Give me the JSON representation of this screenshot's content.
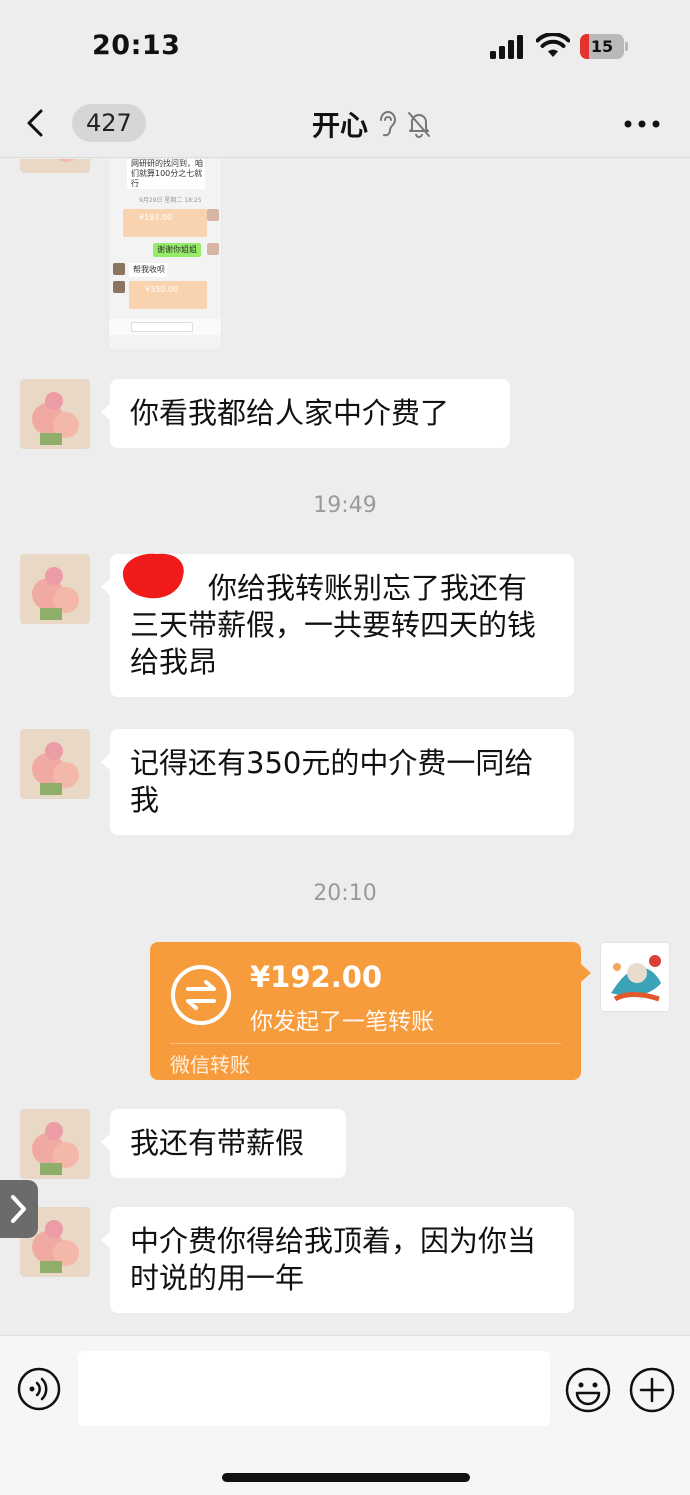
{
  "status_bar": {
    "time": "20:13",
    "battery": "15",
    "battery_color": "#e5322d"
  },
  "nav": {
    "back_count": "427",
    "title": "开心",
    "icons": [
      "chevron-left-icon",
      "ear-icon",
      "mute-bell-icon",
      "more-icon"
    ]
  },
  "embedded_screenshot": {
    "lines": [
      "网研研的找问到，咱",
      "们就算100分之七就",
      "行"
    ],
    "date_line": "9月29日 星期二 18:25",
    "thanks": "谢谢你姐姐",
    "help": "帮我收呗",
    "amount1": "¥193.00",
    "amount2": "¥350.00"
  },
  "messages": [
    {
      "id": "m1",
      "text": "你看我都给人家中介费了",
      "sender": "other"
    },
    {
      "id": "t1",
      "text": "19:49",
      "type": "timestamp"
    },
    {
      "id": "m2",
      "text": "你给我转账别忘了我还有三天带薪假，一共要转四天的钱给我昂",
      "sender": "other",
      "redacted_prefix": true
    },
    {
      "id": "m3",
      "text": "记得还有350元的中介费一同给我",
      "sender": "other"
    },
    {
      "id": "t2",
      "text": "20:10",
      "type": "timestamp"
    },
    {
      "id": "m5",
      "text": "我还有带薪假",
      "sender": "other"
    },
    {
      "id": "m6",
      "text": "中介费你得给我顶着，因为你当时说的用一年",
      "sender": "other"
    }
  ],
  "transfer": {
    "amount": "¥192.00",
    "description": "你发起了一笔转账",
    "footer": "微信转账",
    "color": "#f79c3c"
  },
  "input_bar": {
    "value": "",
    "icons": [
      "voice-icon",
      "emoji-icon",
      "plus-icon"
    ]
  }
}
